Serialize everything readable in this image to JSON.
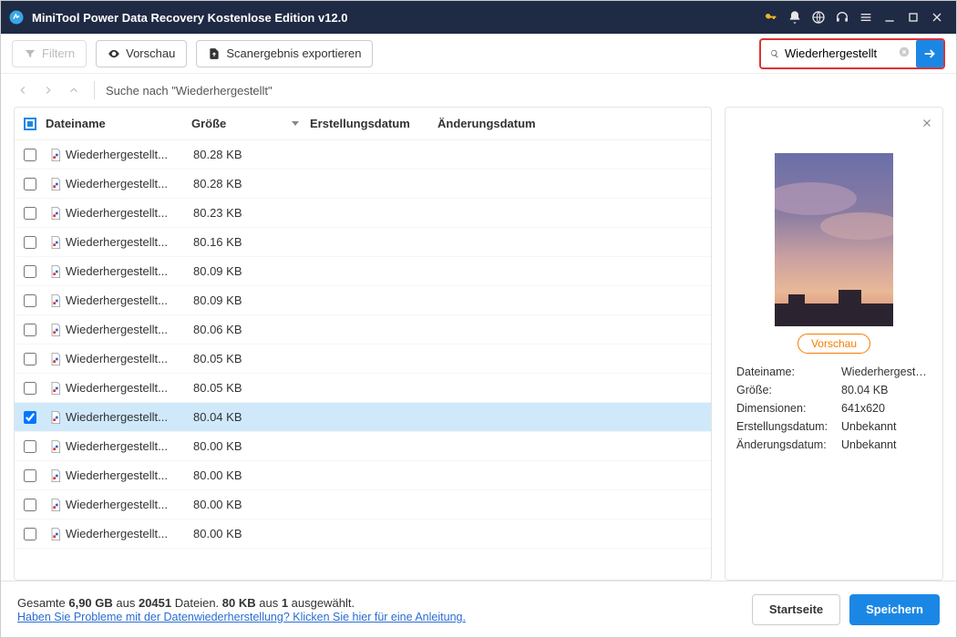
{
  "titlebar": {
    "title": "MiniTool Power Data Recovery Kostenlose Edition v12.0"
  },
  "toolbar": {
    "filter": "Filtern",
    "preview": "Vorschau",
    "export": "Scanergebnis exportieren",
    "search_value": "Wiederhergestellt"
  },
  "breadcrumb": {
    "text": "Suche nach \"Wiederhergestellt\""
  },
  "columns": {
    "name": "Dateiname",
    "size": "Größe",
    "created": "Erstellungsdatum",
    "modified": "Änderungsdatum"
  },
  "rows": [
    {
      "name": "Wiederhergestellt...",
      "size": "80.28 KB",
      "selected": false
    },
    {
      "name": "Wiederhergestellt...",
      "size": "80.28 KB",
      "selected": false
    },
    {
      "name": "Wiederhergestellt...",
      "size": "80.23 KB",
      "selected": false
    },
    {
      "name": "Wiederhergestellt...",
      "size": "80.16 KB",
      "selected": false
    },
    {
      "name": "Wiederhergestellt...",
      "size": "80.09 KB",
      "selected": false
    },
    {
      "name": "Wiederhergestellt...",
      "size": "80.09 KB",
      "selected": false
    },
    {
      "name": "Wiederhergestellt...",
      "size": "80.06 KB",
      "selected": false
    },
    {
      "name": "Wiederhergestellt...",
      "size": "80.05 KB",
      "selected": false
    },
    {
      "name": "Wiederhergestellt...",
      "size": "80.05 KB",
      "selected": false
    },
    {
      "name": "Wiederhergestellt...",
      "size": "80.04 KB",
      "selected": true
    },
    {
      "name": "Wiederhergestellt...",
      "size": "80.00 KB",
      "selected": false
    },
    {
      "name": "Wiederhergestellt...",
      "size": "80.00 KB",
      "selected": false
    },
    {
      "name": "Wiederhergestellt...",
      "size": "80.00 KB",
      "selected": false
    },
    {
      "name": "Wiederhergestellt...",
      "size": "80.00 KB",
      "selected": false
    }
  ],
  "preview": {
    "button": "Vorschau",
    "fields": {
      "filename_label": "Dateiname:",
      "filename_value": "Wiederhergestellt_",
      "size_label": "Größe:",
      "size_value": "80.04 KB",
      "dim_label": "Dimensionen:",
      "dim_value": "641x620",
      "created_label": "Erstellungsdatum:",
      "created_value": "Unbekannt",
      "modified_label": "Änderungsdatum:",
      "modified_value": "Unbekannt"
    }
  },
  "footer": {
    "total_prefix": "Gesamte ",
    "total_size": "6,90 GB",
    "total_mid": " aus ",
    "total_files": "20451",
    "total_suffix": " Dateien.  ",
    "sel_size": "80 KB",
    "sel_mid": " aus ",
    "sel_count": "1",
    "sel_suffix": " ausgewählt.",
    "help_link": "Haben Sie Probleme mit der Datenwiederherstellung? Klicken Sie hier für eine Anleitung.",
    "home": "Startseite",
    "save": "Speichern"
  }
}
